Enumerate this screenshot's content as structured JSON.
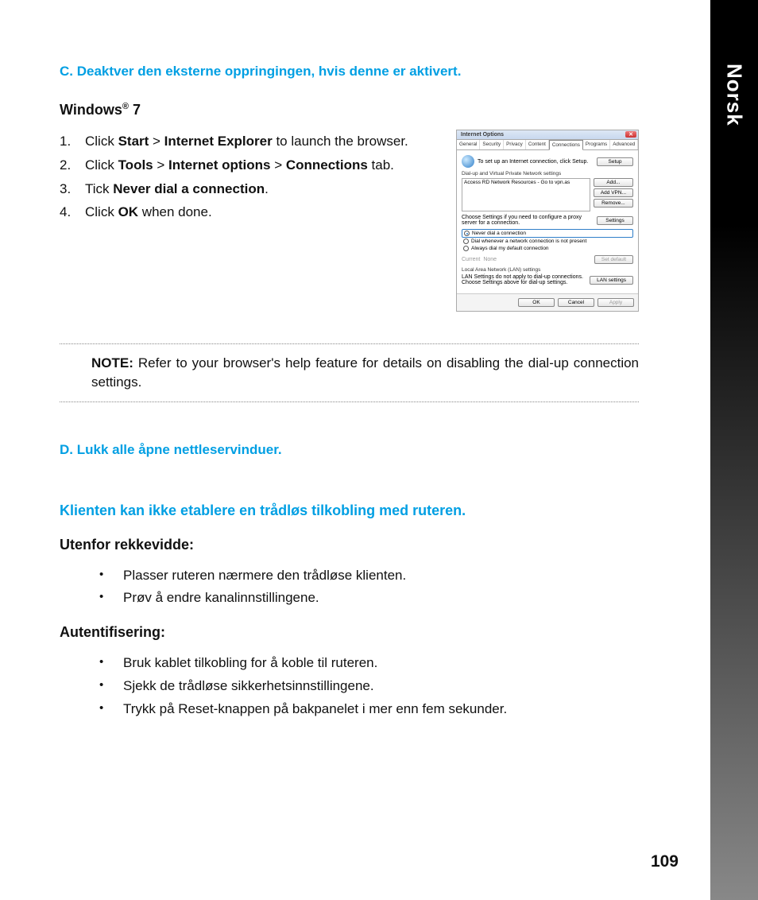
{
  "side_tab": "Norsk",
  "section_c": "C.   Deaktver den eksterne oppringingen, hvis denne er aktivert.",
  "os_heading_prefix": "Windows",
  "os_heading_reg": "®",
  "os_heading_suffix": " 7",
  "steps": {
    "s1a": "Click ",
    "s1b": "Start",
    "s1c": " > ",
    "s1d": "Internet Explorer",
    "s1e": " to launch the browser.",
    "s2a": "Click ",
    "s2b": "Tools",
    "s2c": " > ",
    "s2d": "Internet options",
    "s2e": " > ",
    "s2f": "Connections",
    "s2g": " tab.",
    "s3a": "Tick ",
    "s3b": "Never dial a connection",
    "s3c": ".",
    "s4a": "Click ",
    "s4b": "OK",
    "s4c": " when done."
  },
  "dialog": {
    "title": "Internet Options",
    "tabs": [
      "General",
      "Security",
      "Privacy",
      "Content",
      "Connections",
      "Programs",
      "Advanced"
    ],
    "setup_text": "To set up an Internet connection, click Setup.",
    "setup_btn": "Setup",
    "dialup_label": "Dial-up and Virtual Private Network settings",
    "list_item": "Access RD Network Resources - Go to vpn.as",
    "add_btn": "Add...",
    "addvpn_btn": "Add VPN...",
    "remove_btn": "Remove...",
    "settings_hint": "Choose Settings if you need to configure a proxy server for a connection.",
    "settings_btn": "Settings",
    "radio1": "Never dial a connection",
    "radio2": "Dial whenever a network connection is not present",
    "radio3": "Always dial my default connection",
    "current_label": "Current",
    "current_value": "None",
    "setdefault_btn": "Set default",
    "lan_label": "Local Area Network (LAN) settings",
    "lan_hint": "LAN Settings do not apply to dial-up connections. Choose Settings above for dial-up settings.",
    "lan_btn": "LAN settings",
    "ok": "OK",
    "cancel": "Cancel",
    "apply": "Apply"
  },
  "note_label": "NOTE:  ",
  "note_text": "Refer to your browser's help feature for details on disabling the dial-up connection settings.",
  "section_d": "D.   Lukk alle åpne nettleservinduer.",
  "wireless_heading": "Klienten kan ikke etablere en trådløs tilkobling med ruteren.",
  "out_of_range_heading": "Utenfor rekkevidde:",
  "out_of_range": {
    "b1": "Plasser ruteren nærmere den trådløse klienten.",
    "b2": "Prøv å endre kanalinnstillingene."
  },
  "auth_heading": "Autentifisering:",
  "auth": {
    "b1": "Bruk kablet tilkobling for å koble til ruteren.",
    "b2": "Sjekk de trådløse sikkerhetsinnstillingene.",
    "b3": "Trykk på Reset-knappen på bakpanelet i mer enn fem sekunder."
  },
  "page_number": "109"
}
